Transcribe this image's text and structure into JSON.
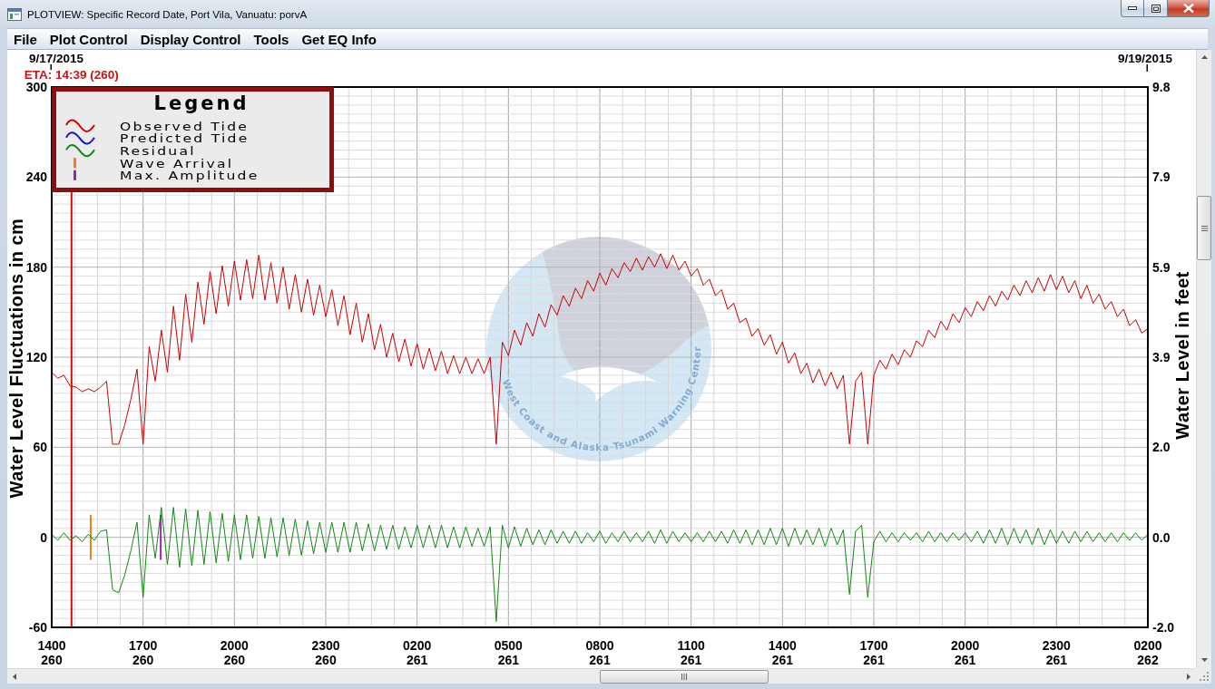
{
  "window": {
    "title": "PLOTVIEW: Specific Record Date, Port Vila, Vanuatu: porvA"
  },
  "menu": [
    "File",
    "Plot Control",
    "Display Control",
    "Tools",
    "Get EQ Info"
  ],
  "plot": {
    "date_labels": {
      "start": "9/17/2015",
      "end": "9/19/2015"
    },
    "chart_data": {
      "type": "line",
      "ylabel": "Water Level Fluctuations in cm",
      "grid": true,
      "legend": "upper left",
      "categories": [
        "1400\n260",
        null,
        null,
        null,
        null,
        null,
        null,
        null,
        null,
        null,
        null,
        null,
        null,
        null,
        null,
        "1700\n260",
        null,
        null,
        null,
        null,
        null,
        null,
        null,
        null,
        null,
        null,
        null,
        null,
        null,
        null,
        "2000\n260",
        null,
        null,
        null,
        null,
        null,
        null,
        null,
        null,
        null,
        null,
        null,
        null,
        null,
        null,
        "2300\n260",
        null,
        null,
        null,
        null,
        null,
        null,
        null,
        null,
        null,
        null,
        null,
        null,
        null,
        null,
        "0200\n261",
        null,
        null,
        null,
        null,
        null,
        null,
        null,
        null,
        null,
        null,
        null,
        null,
        null,
        null,
        "0500\n261",
        null,
        null,
        null,
        null,
        null,
        null,
        null,
        null,
        null,
        null,
        null,
        null,
        null,
        null,
        "0800\n261",
        null,
        null,
        null,
        null,
        null,
        null,
        null,
        null,
        null,
        null,
        null,
        null,
        null,
        null,
        "1100\n261",
        null,
        null,
        null,
        null,
        null,
        null,
        null,
        null,
        null,
        null,
        null,
        null,
        null,
        null,
        "1400\n261",
        null,
        null,
        null,
        null,
        null,
        null,
        null,
        null,
        null,
        null,
        null,
        null,
        null,
        null,
        "1700\n261",
        null,
        null,
        null,
        null,
        null,
        null,
        null,
        null,
        null,
        null,
        null,
        null,
        null,
        null,
        "2000\n261",
        null,
        null,
        null,
        null,
        null,
        null,
        null,
        null,
        null,
        null,
        null,
        null,
        null,
        null,
        "2300\n261",
        null,
        null,
        null,
        null,
        null,
        null,
        null,
        null,
        null,
        null,
        null,
        null,
        null,
        null,
        "0200\n262"
      ],
      "series": [
        {
          "name": "Observed Tide",
          "color": "#cc0000",
          "values": [
            110,
            106,
            108,
            101,
            100,
            97,
            99,
            97,
            100,
            104,
            62,
            62,
            75,
            92,
            112,
            62,
            127,
            104,
            138,
            110,
            154,
            118,
            162,
            130,
            170,
            142,
            177,
            149,
            181,
            154,
            184,
            158,
            185,
            159,
            188,
            158,
            183,
            156,
            180,
            152,
            175,
            150,
            172,
            148,
            168,
            147,
            165,
            141,
            161,
            135,
            156,
            130,
            149,
            125,
            142,
            120,
            136,
            117,
            132,
            114,
            129,
            112,
            126,
            111,
            124,
            109,
            121,
            109,
            120,
            109,
            119,
            109,
            120,
            62,
            130,
            121,
            138,
            128,
            143,
            134,
            149,
            140,
            155,
            148,
            161,
            154,
            166,
            159,
            171,
            164,
            176,
            168,
            179,
            173,
            183,
            177,
            186,
            178,
            187,
            180,
            189,
            179,
            188,
            178,
            184,
            174,
            179,
            168,
            172,
            161,
            165,
            152,
            156,
            143,
            146,
            134,
            139,
            128,
            135,
            122,
            130,
            116,
            123,
            109,
            116,
            103,
            112,
            101,
            110,
            99,
            108,
            62,
            104,
            110,
            62,
            108,
            118,
            112,
            122,
            115,
            125,
            120,
            131,
            127,
            138,
            133,
            144,
            138,
            149,
            143,
            153,
            147,
            157,
            151,
            161,
            154,
            164,
            158,
            168,
            161,
            171,
            163,
            173,
            164,
            175,
            165,
            174,
            163,
            171,
            159,
            168,
            156,
            162,
            152,
            157,
            147,
            152,
            141,
            145,
            136,
            139
          ]
        },
        {
          "name": "Predicted Tide",
          "color": "#1818c0",
          "values": [
            null,
            null,
            null,
            null,
            null,
            null,
            null,
            null,
            null,
            null,
            null,
            null,
            null,
            null,
            null,
            null,
            null,
            null,
            null,
            null,
            null,
            null,
            null,
            null,
            null,
            null,
            null,
            null,
            null,
            null,
            null,
            null,
            null,
            null,
            null,
            null,
            null,
            null,
            null,
            null,
            null,
            null,
            null,
            null,
            null,
            null,
            null,
            null,
            null,
            null,
            null,
            null,
            null,
            null,
            null,
            null,
            null,
            null,
            null,
            null,
            null,
            null,
            null,
            null,
            null,
            null,
            null,
            null,
            null,
            null,
            null,
            null,
            null,
            null,
            null,
            null,
            null,
            null,
            null,
            null,
            null,
            null,
            null,
            null,
            null,
            null,
            null,
            null,
            null,
            null,
            null,
            null,
            null,
            null,
            null,
            null,
            null,
            null,
            null,
            null,
            null,
            null,
            null,
            null,
            null,
            null,
            null,
            null,
            null,
            null,
            null,
            null,
            null,
            null,
            null,
            null,
            null,
            null,
            null,
            null,
            null,
            null,
            null,
            null,
            null,
            null,
            null,
            null,
            null,
            null,
            null,
            null,
            null,
            null,
            null,
            null,
            null,
            null,
            null,
            null,
            null,
            null,
            null,
            null,
            null,
            null,
            null,
            null,
            null,
            null,
            null,
            null,
            null,
            null,
            null,
            null,
            null,
            null,
            null,
            null,
            null,
            null,
            null,
            null,
            null,
            null,
            null,
            null,
            null,
            null,
            null,
            null,
            null,
            null,
            null,
            null,
            null,
            null,
            null,
            null,
            null
          ]
        },
        {
          "name": "Residual",
          "color": "#118811",
          "values": [
            2,
            -2,
            3,
            -2,
            1,
            -3,
            2,
            -2,
            4,
            5,
            -35,
            -37,
            -25,
            -9,
            10,
            -40,
            15,
            -14,
            20,
            -18,
            20,
            -20,
            19,
            -19,
            18,
            -18,
            17,
            -17,
            16,
            -16,
            15,
            -15,
            15,
            -14,
            14,
            -14,
            13,
            -13,
            13,
            -12,
            12,
            -12,
            11,
            -11,
            10,
            -10,
            10,
            -10,
            10,
            -10,
            10,
            -9,
            9,
            -9,
            8,
            -8,
            8,
            -8,
            7,
            -7,
            8,
            -7,
            8,
            -7,
            8,
            -7,
            7,
            -7,
            7,
            -6,
            6,
            -6,
            7,
            -56,
            8,
            -7,
            7,
            -6,
            6,
            -5,
            5,
            -5,
            5,
            -4,
            4,
            -4,
            4,
            -4,
            3,
            -3,
            4,
            -4,
            3,
            -3,
            4,
            -3,
            3,
            -3,
            4,
            -4,
            5,
            -4,
            4,
            -3,
            3,
            -3,
            3,
            -3,
            4,
            -3,
            4,
            -4,
            5,
            -4,
            5,
            -5,
            5,
            -5,
            6,
            -5,
            6,
            -6,
            6,
            -5,
            5,
            -5,
            6,
            -6,
            6,
            -5,
            5,
            -38,
            4,
            8,
            -40,
            -3,
            4,
            -3,
            3,
            -3,
            3,
            -2,
            3,
            -3,
            4,
            -3,
            3,
            -3,
            3,
            -2,
            3,
            -3,
            4,
            -4,
            5,
            -4,
            6,
            -5,
            6,
            -4,
            5,
            -5,
            6,
            -5,
            5,
            -4,
            4,
            -4,
            4,
            -3,
            4,
            -3,
            3,
            -3,
            3,
            -3,
            3,
            -2,
            3,
            -2,
            2
          ]
        }
      ],
      "ylim": [
        -60,
        300
      ],
      "yticks": [
        -60,
        0,
        60,
        120,
        180,
        240,
        300
      ],
      "annotations": [
        "ETA: 14:39 (260)"
      ]
    },
    "right_axis": {
      "label": "Water Level in feet",
      "ticks": [
        "9.8",
        "7.9",
        "5.9",
        "3.9",
        "2.0",
        "0.0",
        "-2.0"
      ]
    },
    "legend": {
      "title": "Legend",
      "items": [
        {
          "label": "Wave Arrival",
          "color": "#f07f1a"
        },
        {
          "label": "Max. Amplitude",
          "color": "#a020b0"
        }
      ]
    },
    "logo": {
      "text": "West Coast and Alaska Tsunami Warning Center"
    }
  }
}
